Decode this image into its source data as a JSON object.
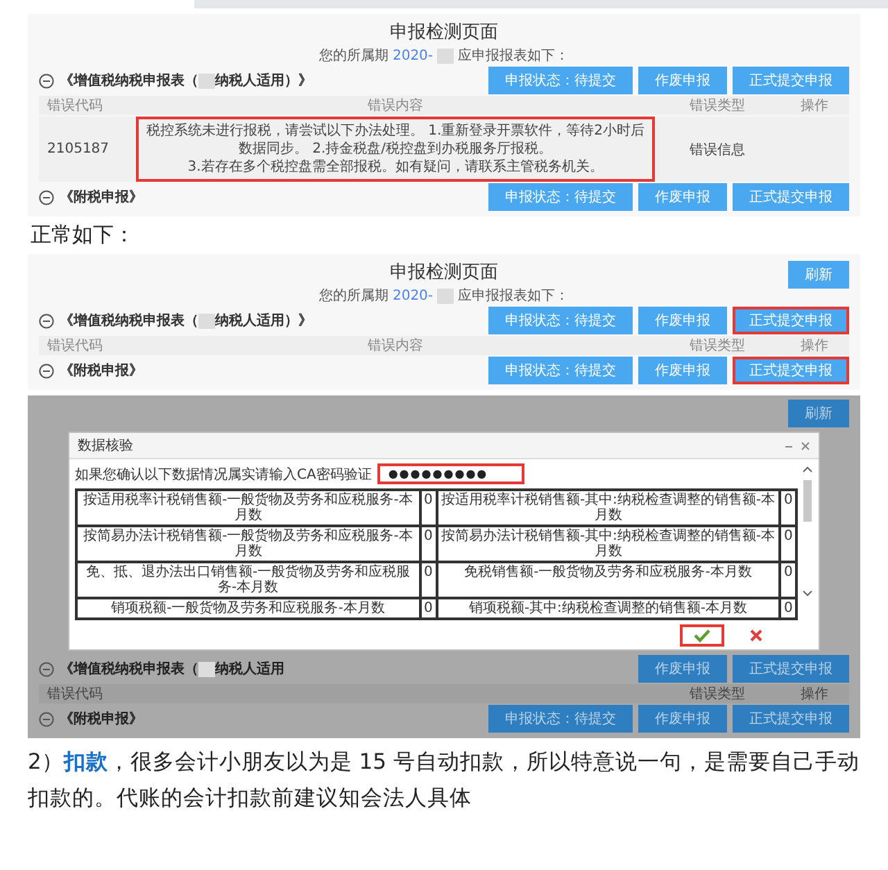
{
  "panels": [
    {
      "kind": "error_page",
      "title": "申报检测页面",
      "period": {
        "prefix": "您的所属期",
        "value": "2020-",
        "suffix": "应申报报表如下："
      },
      "sections": [
        {
          "name_parts": [
            "《增值税纳税申报表（",
            "纳税人适用）》"
          ],
          "buttons": [
            {
              "label": "申报状态：待提交",
              "highlighted": false
            },
            {
              "label": "作废申报",
              "highlighted": false
            },
            {
              "label": "正式提交申报",
              "highlighted": false
            }
          ],
          "table": {
            "columns": [
              "错误代码",
              "错误内容",
              "错误类型",
              "操作"
            ],
            "rows": [
              {
                "code": "2105187",
                "content": [
                  "税控系统未进行报税，请尝试以下办法处理。 1.重新登录开票软件，等待2小时后数据同步。 2.持金税盘/税控盘到办税服务厅报税。",
                  "3.若存在多个税控盘需全部报税。如有疑问，请联系主管税务机关。"
                ],
                "type": "错误信息",
                "highlighted": true
              }
            ]
          }
        },
        {
          "name_parts": [
            "《附税申报》"
          ],
          "buttons": [
            {
              "label": "申报状态：待提交",
              "highlighted": false
            },
            {
              "label": "作废申报",
              "highlighted": false
            },
            {
              "label": "正式提交申报",
              "highlighted": false
            }
          ]
        }
      ]
    },
    {
      "kind": "caption",
      "text": "正常如下："
    },
    {
      "kind": "normal_page",
      "refresh_button": "刷新",
      "title": "申报检测页面",
      "period": {
        "prefix": "您的所属期",
        "value": "2020-",
        "suffix": "应申报报表如下："
      },
      "sections": [
        {
          "name_parts": [
            "《增值税纳税申报表（",
            "纳税人适用）》"
          ],
          "buttons": [
            {
              "label": "申报状态：待提交",
              "highlighted": false
            },
            {
              "label": "作废申报",
              "highlighted": false
            },
            {
              "label": "正式提交申报",
              "highlighted": true
            }
          ],
          "table": {
            "columns": [
              "错误代码",
              "错误内容",
              "错误类型",
              "操作"
            ]
          }
        },
        {
          "name_parts": [
            "《附税申报》"
          ],
          "buttons": [
            {
              "label": "申报状态：待提交",
              "highlighted": false
            },
            {
              "label": "作废申报",
              "highlighted": false
            },
            {
              "label": "正式提交申报",
              "highlighted": true
            }
          ]
        }
      ]
    },
    {
      "kind": "dialog_page",
      "refresh_button": "刷新",
      "dialog": {
        "title": "数据核验",
        "prompt": "如果您确认以下数据情况属实请输入CA密码验证",
        "password": "●●●●●●●●●",
        "password_highlighted": true,
        "rows": [
          [
            "按适用税率计税销售额-一般货物及劳务和应税服务-本月数",
            "0",
            "按适用税率计税销售额-其中:纳税检查调整的销售额-本月数",
            "0"
          ],
          [
            "按简易办法计税销售额-一般货物及劳务和应税服务-本月数",
            "0",
            "按简易办法计税销售额-其中:纳税检查调整的销售额-本月数",
            "0"
          ],
          [
            "免、抵、退办法出口销售额-一般货物及劳务和应税服务-本月数",
            "0",
            "免税销售额-一般货物及劳务和应税服务-本月数",
            "0"
          ],
          [
            "销项税额-一般货物及劳务和应税服务-本月数",
            "0",
            "销项税额-其中:纳税检查调整的销售额-本月数",
            "0"
          ]
        ],
        "confirm_highlighted": true
      },
      "sections": [
        {
          "name_parts": [
            "《增值税纳税申报表（",
            "纳税人适用"
          ],
          "buttons": [
            {
              "label": "作废申报",
              "highlighted": false
            },
            {
              "label": "正式提交申报",
              "highlighted": false
            }
          ],
          "table": {
            "columns": [
              "错误代码",
              "错误类型",
              "操作"
            ]
          }
        },
        {
          "name_parts": [
            "《附税申报》"
          ],
          "buttons": [
            {
              "label": "申报状态：待提交",
              "highlighted": false
            },
            {
              "label": "作废申报",
              "highlighted": false
            },
            {
              "label": "正式提交申报",
              "highlighted": false
            }
          ]
        }
      ]
    },
    {
      "kind": "paragraph",
      "text": "2）**扣款**，很多会计小朋友以为是 15 号自动扣款，所以特意说一句，是需要自己手动扣款的。代账的会计扣款前建议知会法人具体"
    }
  ]
}
